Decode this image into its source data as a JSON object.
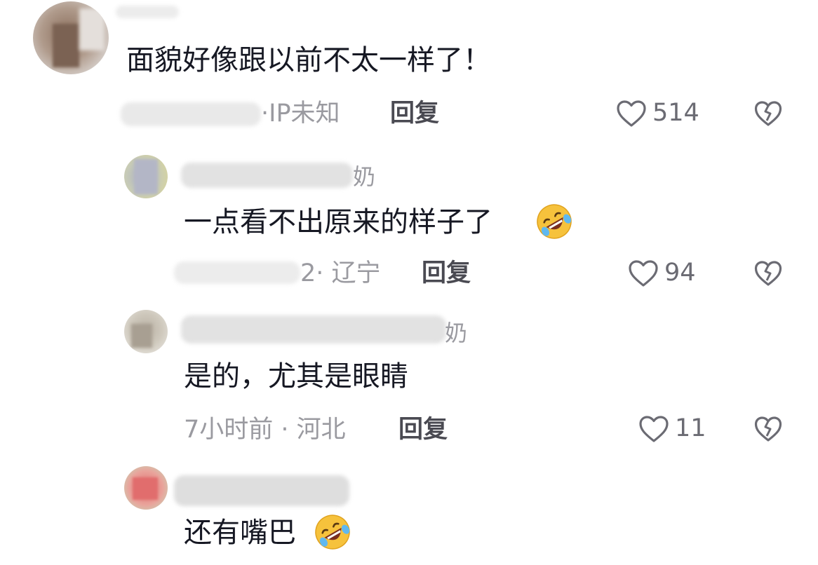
{
  "comments": [
    {
      "username_tail": "",
      "text": "面貌好像跟以前不太一样了！",
      "meta": "·IP未知",
      "reply": "回复",
      "likes": "514",
      "emoji": ""
    },
    {
      "username_tail": "奶",
      "text": "一点看不出原来的样子了",
      "meta": "2· 辽宁",
      "reply": "回复",
      "likes": "94",
      "emoji": "rolling-on-floor-laughing"
    },
    {
      "username_tail": "奶",
      "text": "是的，尤其是眼睛",
      "meta": "7小时前 · 河北",
      "reply": "回复",
      "likes": "11",
      "emoji": ""
    },
    {
      "username_tail": "",
      "text": "还有嘴巴",
      "meta": "",
      "reply": "",
      "likes": "",
      "emoji": "rolling-on-floor-laughing"
    }
  ],
  "icons": {
    "like": "heart-outline-icon",
    "dislike": "broken-heart-icon"
  },
  "colors": {
    "text": "#161823",
    "meta": "#9a9aa0",
    "reply": "#4a4a52",
    "icon": "#6b6b73"
  }
}
